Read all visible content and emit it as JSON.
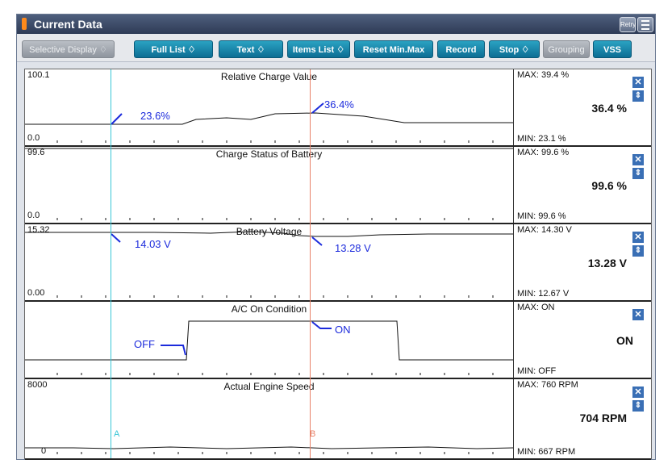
{
  "window": {
    "title": "Current Data",
    "retry_label": "Retry"
  },
  "toolbar": [
    {
      "name": "selective-display-button",
      "label": "Selective Display ♢",
      "enabled": false
    },
    {
      "name": "full-list-button",
      "label": "Full List     ♢",
      "enabled": true
    },
    {
      "name": "text-button",
      "label": "Text     ♢",
      "enabled": true
    },
    {
      "name": "items-list-button",
      "label": "Items List ♢",
      "enabled": true
    },
    {
      "name": "reset-minmax-button",
      "label": "Reset Min.Max",
      "enabled": true
    },
    {
      "name": "record-button",
      "label": "Record",
      "enabled": true
    },
    {
      "name": "stop-button",
      "label": "Stop  ♢",
      "enabled": true
    },
    {
      "name": "grouping-button",
      "label": "Grouping",
      "enabled": false
    },
    {
      "name": "vss-button",
      "label": "VSS",
      "enabled": true
    }
  ],
  "cursors": {
    "a_label": "A",
    "b_label": "B"
  },
  "panels": [
    {
      "name": "Relative Charge Value",
      "ymax": "100.1",
      "ymin": "0.0",
      "max": "MAX:  39.4 %",
      "min": "MIN:  23.1 %",
      "current": "36.4 %",
      "annotations": [
        "23.6%",
        "36.4%"
      ]
    },
    {
      "name": "Charge Status of Battery",
      "ymax": "99.6",
      "ymin": "0.0",
      "max": "MAX:  99.6 %",
      "min": "MIN:  99.6 %",
      "current": "99.6 %",
      "annotations": []
    },
    {
      "name": "Battery Voltage",
      "ymax": "15.32",
      "ymin": "0.00",
      "max": "MAX:  14.30 V",
      "min": "MIN: 12.67 V",
      "current": "13.28 V",
      "annotations": [
        "14.03 V",
        "13.28 V"
      ]
    },
    {
      "name": "A/C On Condition",
      "ymax": "",
      "ymin": "",
      "max": "MAX:  ON",
      "min": "MIN:  OFF",
      "current": "ON",
      "annotations": [
        "OFF",
        "ON"
      ]
    },
    {
      "name": "Actual Engine Speed",
      "ymax": "8000",
      "ymin": "0",
      "max": "MAX:     760 RPM",
      "min": "MIN:    667 RPM",
      "current": "704 RPM",
      "annotations": []
    }
  ],
  "colors": {
    "cursor_a": "#39c6d6",
    "cursor_b": "#e8836a",
    "annotation": "#1c2bdc",
    "button": "#0f7aa3"
  }
}
